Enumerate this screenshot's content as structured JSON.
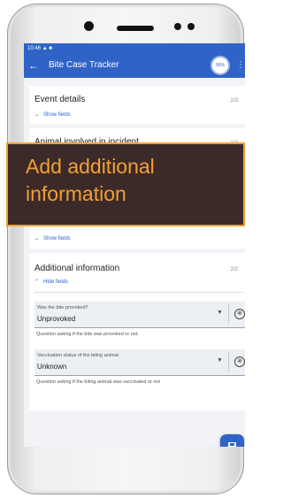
{
  "status_bar": {
    "time": "10:46",
    "icons": "▲ ■"
  },
  "app_bar": {
    "back_icon": "arrow-left",
    "title": "Bite Case Tracker",
    "progress": "66%",
    "menu_icon": "more-vert"
  },
  "sections": [
    {
      "title": "Event details",
      "count": "2/3",
      "toggle": "Show fields"
    },
    {
      "title": "Animal involved in incident",
      "count": "1/2",
      "toggle": "Show fields"
    },
    {
      "title": "Additional information",
      "count": "2/2",
      "toggle": "Hide fields"
    }
  ],
  "fields": [
    {
      "label": "Was the bite provoked?",
      "value": "Unprovoked",
      "hint": "Question asking if the bite was provoked or not."
    },
    {
      "label": "Vaccination status of the biting animal",
      "value": "Unknown",
      "hint": "Question asking if the biting animal was vaccinated or not"
    }
  ],
  "overlay": {
    "text": "Add additional information"
  },
  "colors": {
    "primary": "#2f63c8",
    "overlay_bg": "#3c2a28",
    "overlay_text": "#f2a035"
  }
}
